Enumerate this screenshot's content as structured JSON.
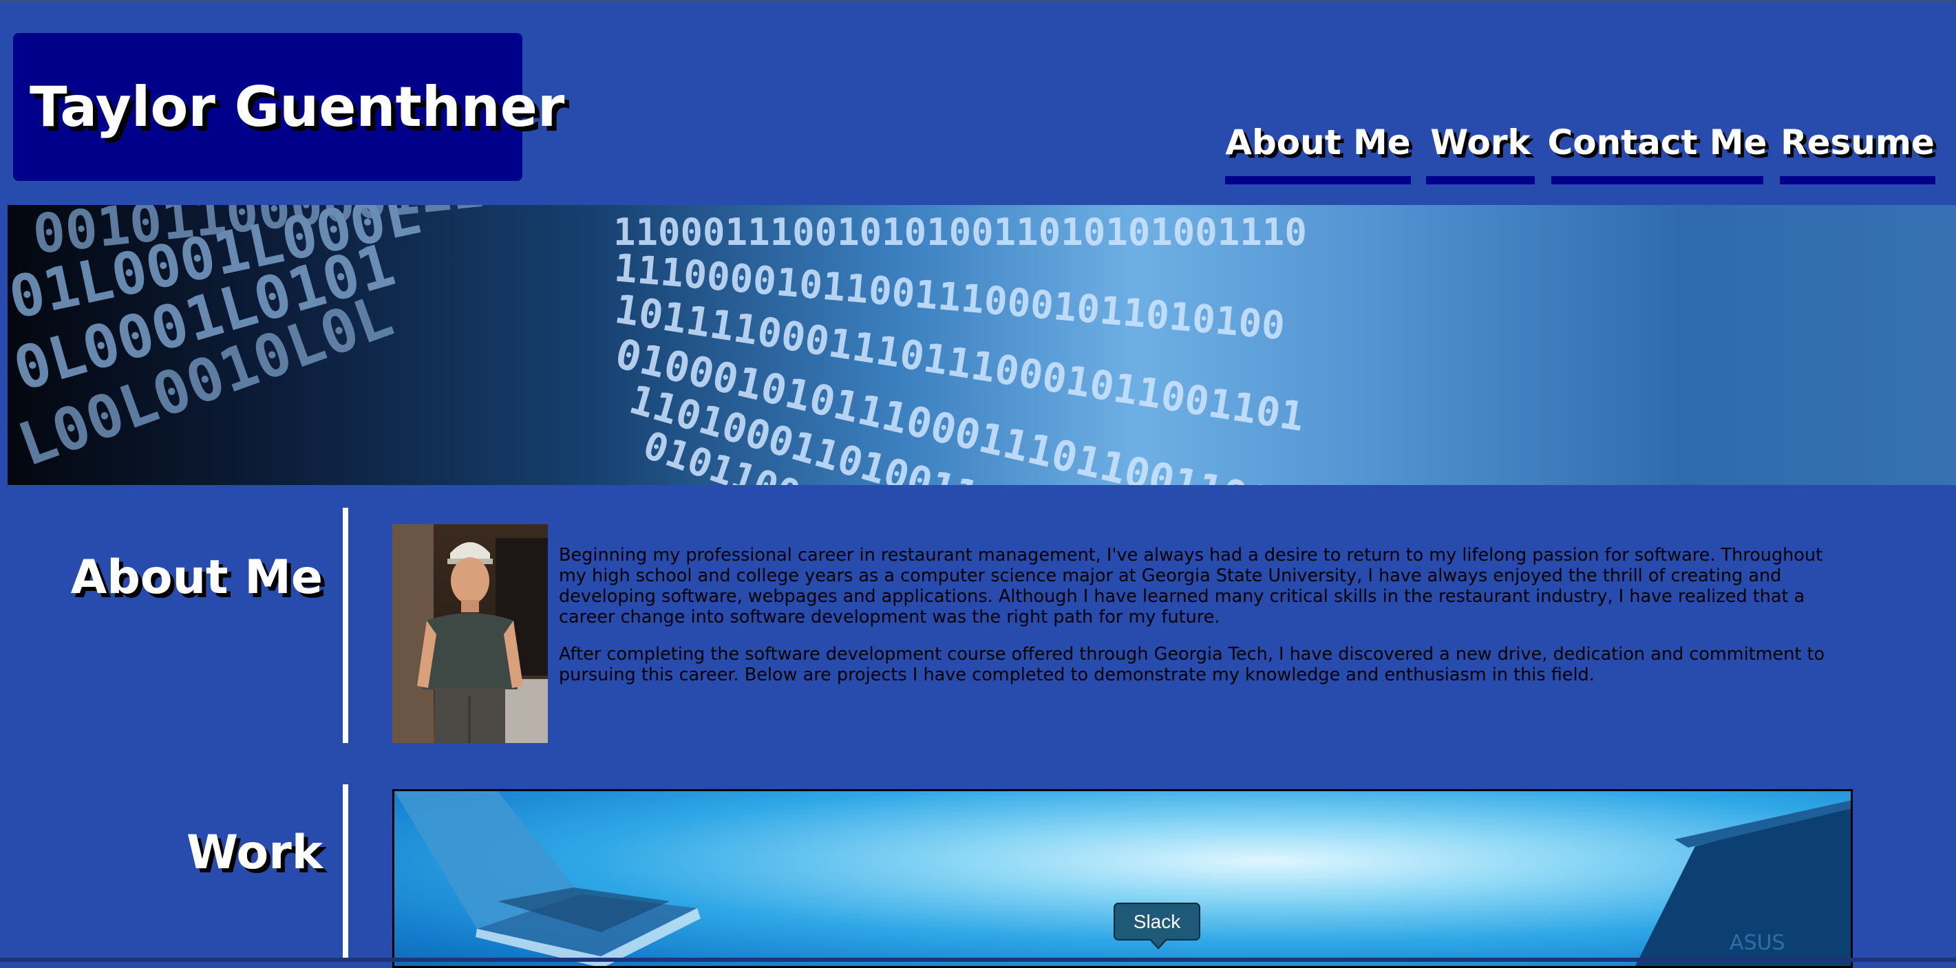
{
  "header": {
    "site_title": "Taylor Guenthner",
    "nav": [
      {
        "label": "About Me"
      },
      {
        "label": "Work"
      },
      {
        "label": "Contact Me"
      },
      {
        "label": "Resume"
      }
    ]
  },
  "banner": {
    "image": "binary-code-tunnel"
  },
  "about": {
    "heading": "About Me",
    "photo": "profile-photo",
    "paragraphs": [
      "Beginning my professional career in restaurant management, I've always had a desire to return to my lifelong passion for software. Throughout my high school and college years as a computer science major at Georgia State University, I have always enjoyed the thrill of creating and developing software, webpages and applications. Although I have learned many critical skills in the restaurant industry, I have realized that a career change into software development was the right path for my future.",
      "After completing the software development course offered through Georgia Tech, I have discovered a new drive, dedication and commitment to pursuing this career. Below are projects I have completed to demonstrate my knowledge and enthusiasm in this field."
    ]
  },
  "work": {
    "heading": "Work",
    "image": "laptops-project-image"
  },
  "tooltip": {
    "label": "Slack"
  },
  "colors": {
    "page_background": "#284cad",
    "title_box": "#00008b",
    "nav_underline": "#00008b",
    "heading_text": "#ffffff",
    "tooltip_background": "#1e5a78"
  }
}
